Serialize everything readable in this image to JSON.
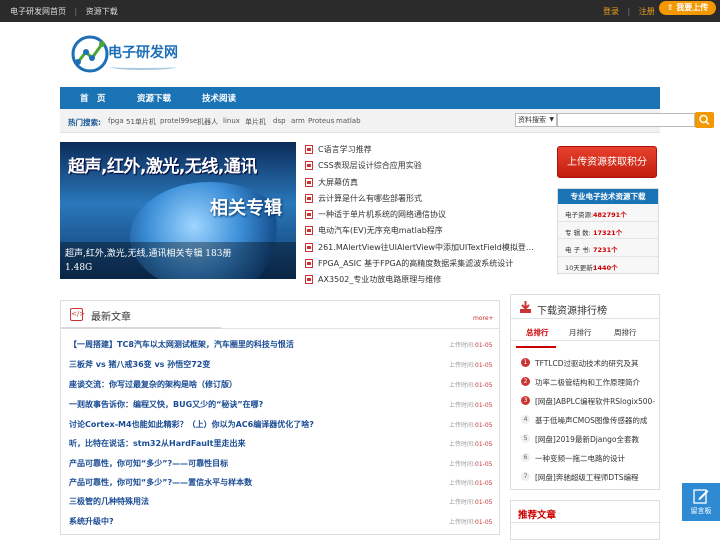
{
  "topbar": {
    "links": [
      "电子研发网首页",
      "资源下载"
    ],
    "separator": "|",
    "login": "登录",
    "register": "注册",
    "upload_button": "我要上传"
  },
  "logo": {
    "text": "电子研发网"
  },
  "nav": {
    "items": [
      "首　页",
      "资源下载",
      "技术阅读"
    ]
  },
  "hotsearch": {
    "label": "热门搜索:",
    "keywords": [
      "fpga",
      "51单片机",
      "protel99se",
      "机器人",
      "linux",
      "单片机",
      "dsp",
      "arm",
      "Proteus",
      "matlab"
    ],
    "select_value": "资料搜索"
  },
  "banner": {
    "headline": "超声,红外,激光,无线,通讯",
    "badge": "相关专辑",
    "caption_line1": "超声,红外,激光,无线,通讯相关专辑 183册",
    "caption_line2": "1.48G"
  },
  "files": [
    "C语言学习推荐",
    "CSS表现层设计综合应用实验",
    "大屏幕仿真",
    "云计算是什么有哪些部署形式",
    "一种适于单片机系统的网络通信协议",
    "电动汽车(EV)无序充电matlab程序",
    "261.MAlertView往UIAlertView中添加UITextField模拟登…",
    "FPGA_ASIC 基于FPGA的高精度数据采集滤波系统设计",
    "AX3502_专业功放电路原理与维修"
  ],
  "upload_cta": "上传资源获取积分",
  "resource_stats": {
    "title": "专业电子技术资源下载",
    "rows": [
      {
        "label": "电子资源:",
        "value": "482791个"
      },
      {
        "label": "专 辑 数:",
        "value": "17321个"
      },
      {
        "label": "电 子 书:",
        "value": "7231个"
      },
      {
        "label": "10天更新:",
        "value": "1440个"
      }
    ]
  },
  "latest": {
    "title": "最新文章",
    "more": "more+",
    "time_label": "上传时间:",
    "items": [
      {
        "title": "【一周搭建】TC8汽车以太网测试框架，汽车圈里的科技与恨活",
        "date": "01-05"
      },
      {
        "title": "三板斧 vs 猪八戒36变 vs 孙悟空72变",
        "date": "01-05"
      },
      {
        "title": "座谈交流：你写过最复杂的架构是啥（修订版）",
        "date": "01-05"
      },
      {
        "title": "一则故事告诉你：编程又快，BUG又少的“秘诀”在哪?",
        "date": "01-05"
      },
      {
        "title": "讨论Cortex-M4也能如此精彩？（上）你以为AC6编译器优化了啥?",
        "date": "01-05"
      },
      {
        "title": "听，比特在说话：stm32从HardFault里走出来",
        "date": "01-05"
      },
      {
        "title": "产品可靠性，你可知“多少”?——可靠性目标",
        "date": "01-05"
      },
      {
        "title": "产品可靠性，你可知“多少”?——置信水平与样本数",
        "date": "01-05"
      },
      {
        "title": "三极管的几种特殊用法",
        "date": "01-05"
      },
      {
        "title": "系统升级中?",
        "date": "01-05"
      }
    ]
  },
  "ranking": {
    "title": "下载资源排行榜",
    "tabs": [
      "总排行",
      "月排行",
      "周排行"
    ],
    "items": [
      "TFTLCD过驱动技术的研究及其",
      "功率二极管结构和工作原理简介",
      "[网盘]ABPLC编程软件RSlogix500-",
      "基于低噪声CMOS图像传感器的成",
      "[网盘]2019最新Django全套教",
      "一种变频一拖二电路的设计",
      "[网盘]奔驰超级工程师DTS编程"
    ]
  },
  "recommend": {
    "title": "推荐文章"
  },
  "message_board": "留言板"
}
